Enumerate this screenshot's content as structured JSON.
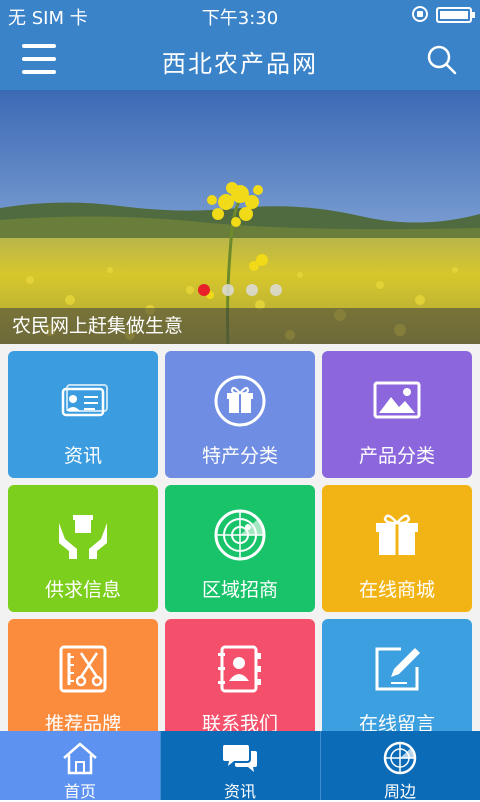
{
  "status_bar": {
    "carrier": "无 SIM 卡",
    "time": "下午3:30"
  },
  "header": {
    "title": "西北农产品网",
    "menu_icon": "hamburger-menu-icon",
    "search_icon": "search-icon"
  },
  "banner": {
    "caption": "农民网上赶集做生意",
    "slide_count": 4,
    "active_slide": 1
  },
  "tiles": [
    {
      "label": "资讯",
      "icon": "id-card-icon",
      "color": "#3b9de0"
    },
    {
      "label": "特产分类",
      "icon": "gift-circle-icon",
      "color": "#6f8ee3"
    },
    {
      "label": "产品分类",
      "icon": "image-icon",
      "color": "#8b66dd"
    },
    {
      "label": "供求信息",
      "icon": "hands-gift-icon",
      "color": "#7ccf1d"
    },
    {
      "label": "区域招商",
      "icon": "radar-icon",
      "color": "#19c36a"
    },
    {
      "label": "在线商城",
      "icon": "gift-box-icon",
      "color": "#f2b415"
    },
    {
      "label": "推荐品牌",
      "icon": "scissors-ruler-icon",
      "color": "#fb8b3d"
    },
    {
      "label": "联系我们",
      "icon": "address-book-icon",
      "color": "#f4506c"
    },
    {
      "label": "在线留言",
      "icon": "edit-note-icon",
      "color": "#3c9fdf"
    }
  ],
  "tabs": [
    {
      "label": "首页",
      "icon": "home-icon",
      "active": true
    },
    {
      "label": "资讯",
      "icon": "chat-icon",
      "active": false
    },
    {
      "label": "周边",
      "icon": "radar-icon",
      "active": false
    }
  ]
}
